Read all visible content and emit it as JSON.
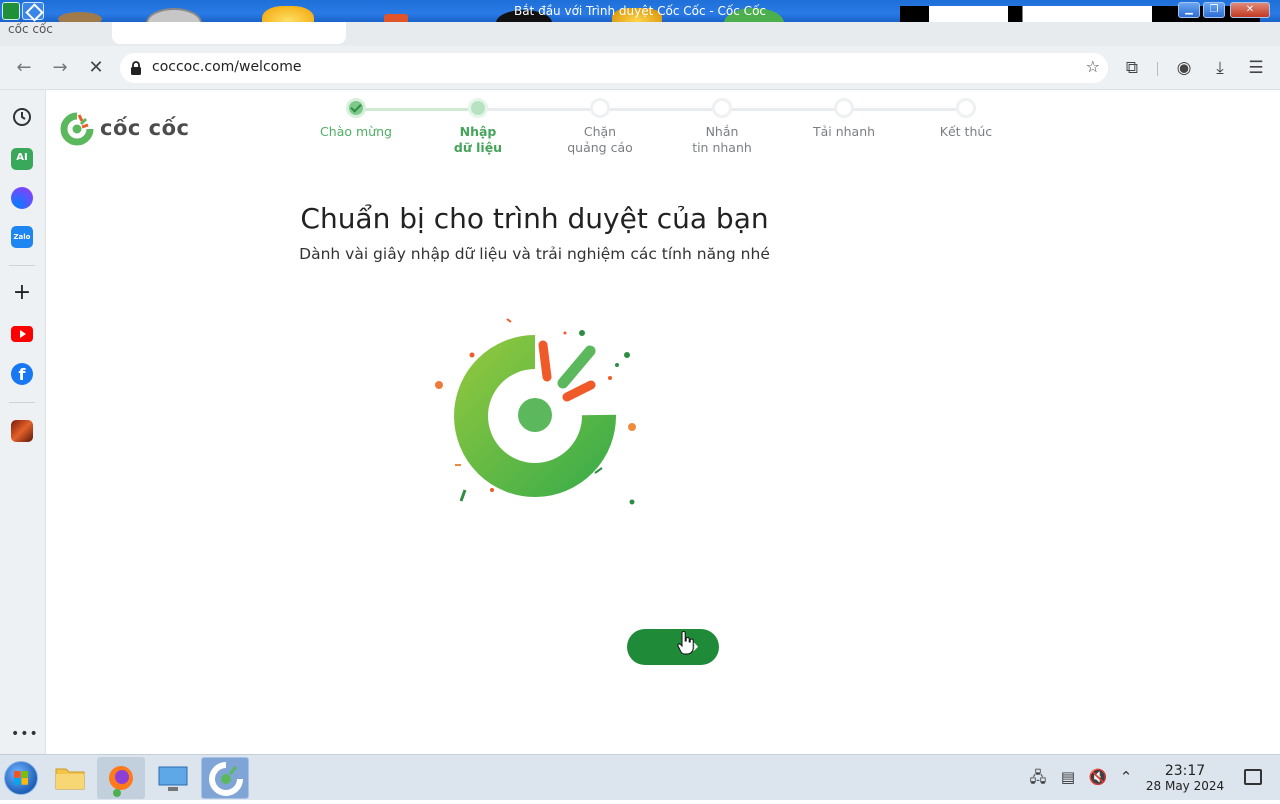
{
  "window": {
    "title": "Bắt đầu với Trình duyệt Cốc Cốc - Cốc Cốc",
    "minimize_icon": "minimize-icon",
    "maximize_icon": "restore-icon",
    "close_icon": "close-icon"
  },
  "tab": {
    "fragment": "cốc cốc"
  },
  "address_bar": {
    "url": "coccoc.com/welcome",
    "icons": [
      "back-icon",
      "forward-icon",
      "stop-icon",
      "lock-icon",
      "star-icon"
    ]
  },
  "toolbar": {
    "icons": [
      "extensions-icon",
      "profile-icon",
      "download-icon",
      "menu-icon"
    ]
  },
  "sidebar": {
    "items": [
      {
        "icon": "history-icon"
      },
      {
        "icon": "ai-icon",
        "label": "AI"
      },
      {
        "icon": "messenger-icon"
      },
      {
        "icon": "zalo-icon",
        "label": "Zalo"
      },
      {
        "icon": "add-icon"
      },
      {
        "icon": "youtube-icon"
      },
      {
        "icon": "facebook-icon"
      },
      {
        "icon": "game-icon"
      }
    ],
    "more_label": "•••"
  },
  "page": {
    "logo_text": "cốc cốc",
    "steps": [
      {
        "label": "Chào mừng",
        "state": "done"
      },
      {
        "label": "Nhập\ndữ liệu",
        "state": "active"
      },
      {
        "label": "Chặn\nquảng cáo",
        "state": "pending"
      },
      {
        "label": "Nhắn\ntin nhanh",
        "state": "pending"
      },
      {
        "label": "Tải nhanh",
        "state": "pending"
      },
      {
        "label": "Kết thúc",
        "state": "pending"
      }
    ],
    "heading": "Chuẩn bị cho trình duyệt của bạn",
    "subheading": "Dành vài giây nhập dữ liệu và trải nghiệm các tính năng nhé",
    "next_button_icon": "arrow-right-icon"
  },
  "colors": {
    "brand_green": "#1f8a38",
    "logo_green": "#5cb85c",
    "accent_orange": "#f05a28"
  },
  "taskbar": {
    "apps": [
      "file-explorer-icon",
      "firefox-icon",
      "remote-desktop-icon",
      "coccoc-icon"
    ],
    "tray": [
      "network-icon",
      "clipboard-icon",
      "volume-muted-icon",
      "chevron-up-icon"
    ],
    "time": "23:17",
    "date": "28 May 2024"
  }
}
